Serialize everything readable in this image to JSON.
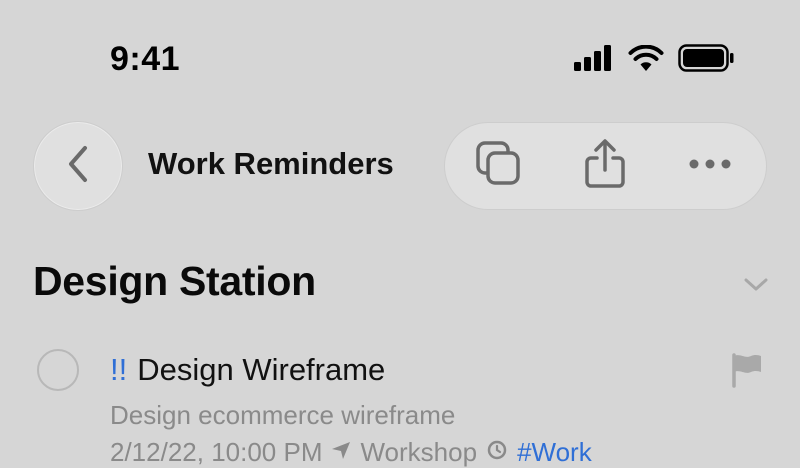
{
  "status_bar": {
    "time": "9:41",
    "icons": [
      "cellular-signal-icon",
      "wifi-icon",
      "battery-icon"
    ]
  },
  "header": {
    "title": "Work Reminders",
    "back_icon": "chevron-left-icon",
    "actions": [
      "copy-icon",
      "share-icon",
      "more-icon"
    ]
  },
  "section": {
    "title": "Design Station",
    "chevron": "chevron-down-icon"
  },
  "reminders": [
    {
      "priority": "!!",
      "title": "Design Wireframe",
      "notes": "Design ecommerce wireframe",
      "date": "2/12/22, 10:00 PM",
      "location": "Workshop",
      "tag": "#Work",
      "flagged": true
    }
  ],
  "colors": {
    "background": "#d6d6d6",
    "accent": "#2f6fd6",
    "secondary_text": "#8a8a8a"
  }
}
